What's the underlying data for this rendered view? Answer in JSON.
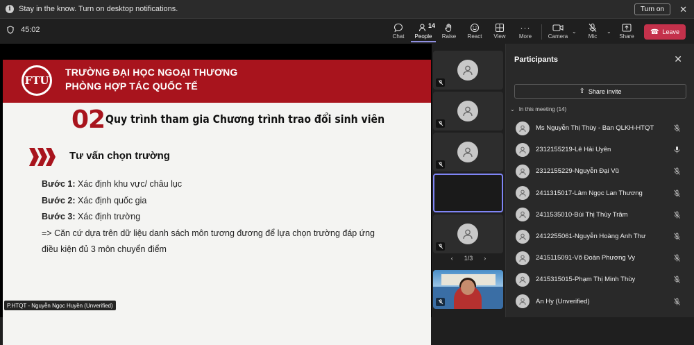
{
  "notification": {
    "message": "Stay in the know. Turn on desktop notifications.",
    "turn_on_label": "Turn on",
    "close_icon": "close-icon"
  },
  "toolbar": {
    "timer": "45:02",
    "chat": "Chat",
    "people": "People",
    "people_count": "14",
    "raise": "Raise",
    "react": "React",
    "view": "View",
    "more": "More",
    "camera": "Camera",
    "mic": "Mic",
    "share": "Share",
    "leave": "Leave"
  },
  "slide": {
    "logo_text": "FTU",
    "university_line1": "TRƯỜNG ĐẠI HỌC NGOẠI THƯƠNG",
    "university_line2": "PHÒNG HỢP TÁC QUỐC TẾ",
    "section_number": "02",
    "section_title": "Quy trình tham gia Chương trình trao đổi sinh viên",
    "subtitle": "Tư vấn chọn trường",
    "steps": [
      {
        "label": "Bước 1:",
        "text": " Xác định khu vực/ châu lục"
      },
      {
        "label": "Bước 2:",
        "text": " Xác định quốc gia"
      },
      {
        "label": "Bước 3:",
        "text": " Xác định trường"
      }
    ],
    "note_line1": "=> Căn cứ dựa trên dữ liệu danh sách môn tương đương để lựa chọn trường đáp ứng",
    "note_line2": "điều kiện đủ 3 môn chuyển điểm"
  },
  "presenter_name": "P.HTQT - Nguyễn Ngọc Huyền (Unverified)",
  "gallery": {
    "page": "1/3"
  },
  "participants_panel": {
    "title": "Participants",
    "share_invite": "Share invite",
    "section_label": "In this meeting (14)",
    "people": [
      {
        "name": "Ms Nguyễn Thị Thùy - Ban QLKH-HTQT",
        "muted": true
      },
      {
        "name": "2312155219-Lê Hải Uyên",
        "muted": false
      },
      {
        "name": "2312155229-Nguyễn Đại Vũ",
        "muted": true
      },
      {
        "name": "2411315017-Lâm Ngọc Lan Thương",
        "muted": true
      },
      {
        "name": "2411535010-Bùi Thị Thùy Trâm",
        "muted": true
      },
      {
        "name": "2412255061-Nguyễn Hoàng Anh Thư",
        "muted": true
      },
      {
        "name": "2415115091-Võ Đoàn Phương Vy",
        "muted": true
      },
      {
        "name": "2415315015-Phạm Thị Minh Thùy",
        "muted": true
      },
      {
        "name": "An Hy (Unverified)",
        "muted": true
      }
    ]
  },
  "colors": {
    "accent": "#a8141d",
    "leave": "#c4314b",
    "selected": "#7f85f5"
  }
}
